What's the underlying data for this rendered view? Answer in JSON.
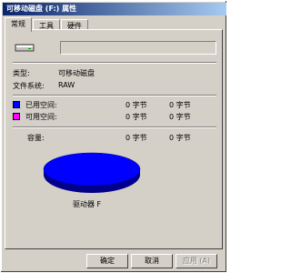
{
  "window": {
    "title": "可移动磁盘 (F:) 属性"
  },
  "tabs": [
    {
      "label": "常规",
      "active": true
    },
    {
      "label": "工具",
      "active": false
    },
    {
      "label": "硬件",
      "active": false
    }
  ],
  "general": {
    "name_value": "",
    "type_label": "类型:",
    "type_value": "可移动磁盘",
    "fs_label": "文件系统:",
    "fs_value": "RAW",
    "used": {
      "label": "已用空间:",
      "bytes": "0 字节",
      "human": "0 字节",
      "color": "#0000ff"
    },
    "free": {
      "label": "可用空间:",
      "bytes": "0 字节",
      "human": "0 字节",
      "color": "#ff00ff"
    },
    "capacity": {
      "label": "容量:",
      "bytes": "0 字节",
      "human": "0 字节"
    },
    "drive_label": "驱动器 F"
  },
  "buttons": {
    "ok": "确定",
    "cancel": "取消",
    "apply": "应用 (A)"
  }
}
